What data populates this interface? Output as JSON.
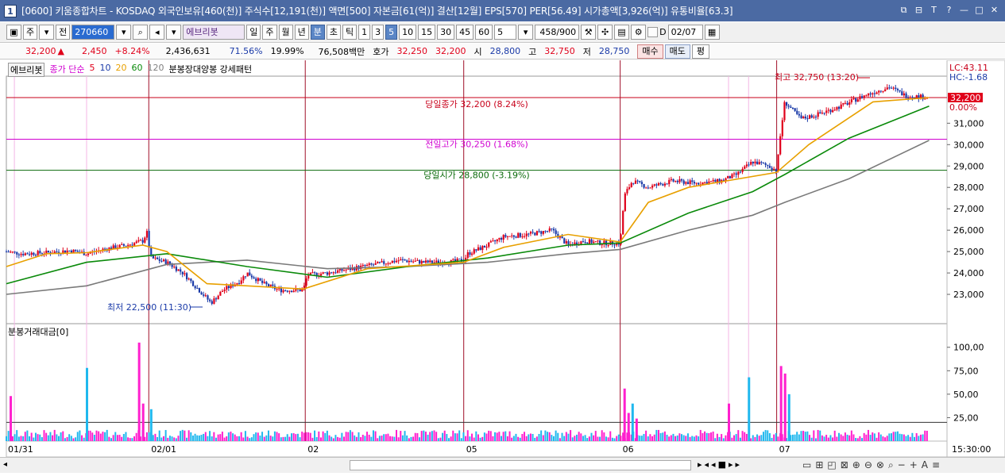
{
  "window": {
    "title": "[0600] 키움종합차트 - KOSDAQ 외국인보유[460(천)] 주식수[12,191(천)] 액면[500] 자본금[61(억)] 결산[12월] EPS[570] PER[56.49] 시가총액[3,926(억)] 유통비율[63.3]",
    "app_icon": "1",
    "controls": [
      "⧉",
      "⊟",
      "T",
      "?",
      "—",
      "□",
      "✕"
    ]
  },
  "toolbar": {
    "period_weekly": "주",
    "full": "전",
    "code": "270660",
    "stock_name": "에브리봇",
    "periods": [
      "일",
      "주",
      "월",
      "년",
      "분",
      "초",
      "틱"
    ],
    "selected_period": "분",
    "intervals": [
      "1",
      "3",
      "5",
      "10",
      "15",
      "30",
      "45",
      "60"
    ],
    "selected_interval": "5",
    "interval_value": "5",
    "count": "458/900",
    "checkbox_label": "D",
    "date": "02/07"
  },
  "quote": {
    "price": "32,200",
    "arrow": "▲",
    "change": "2,450",
    "change_pct": "+8.24%",
    "volume": "2,436,631",
    "pct1": "71.56%",
    "pct2": "19.99%",
    "amount": "76,508백만",
    "ask_label": "호가",
    "ask": "32,250",
    "bid": "32,200",
    "open_label": "시",
    "open": "28,800",
    "high_label": "고",
    "high": "32,750",
    "low_label": "저",
    "low": "28,750",
    "buy": "매수",
    "sell": "매도",
    "avg": "평"
  },
  "legend": {
    "stock": "에브리봇",
    "ma_label": "종가 단순",
    "ma": [
      "5",
      "10",
      "20",
      "60",
      "120"
    ],
    "ma_colors": [
      "#e0001a",
      "#1a3aa8",
      "#e8a000",
      "#0a8a0a",
      "#808080"
    ],
    "pattern": "분봉장대양봉 강세패턴",
    "volume_pane": "분봉거래대금[0]"
  },
  "annotations": {
    "high": "최고 32,750 (13:20)",
    "low": "최저 22,500 (11:30)",
    "today_close": "당일종가 32,200 (8.24%)",
    "prev_high": "전일고가 30,250 (1.68%)",
    "today_open": "당일시가 28,800 (-3.19%)",
    "lc": "LC:43.11",
    "hc": "HC:-1.68",
    "current_tag": "32,200",
    "zero_pct": "0.00%",
    "clock": "15:30:00"
  },
  "colors": {
    "up": "#e0001a",
    "down": "#1a3aa8",
    "vol_up": "#ff1fce",
    "vol_down": "#20b8ee",
    "close_line": "#c8001a",
    "prev_high_line": "#d000d0",
    "open_line": "#0a6a0a"
  },
  "chart_data": {
    "type": "candlestick",
    "price_axis": [
      "31,000",
      "30,000",
      "29,000",
      "28,000",
      "27,000",
      "26,000",
      "25,000",
      "24,000",
      "23,000"
    ],
    "price_ticks": [
      31000,
      30000,
      29000,
      28000,
      27000,
      26000,
      25000,
      24000,
      23000
    ],
    "ylim": [
      22000,
      33200
    ],
    "volume_axis": [
      "100,00",
      "75,00",
      "50,00",
      "25,00"
    ],
    "volume_ticks": [
      100,
      75,
      50,
      25
    ],
    "vol_ylim": [
      0,
      115
    ],
    "date_labels": [
      "01/31",
      "02/01",
      "02",
      "05",
      "06",
      "07"
    ],
    "day_boundaries": [
      0,
      0.1775,
      0.3725,
      0.57,
      0.765,
      0.96
    ],
    "reference_levels": {
      "today_close": 32200,
      "prev_high": 30250,
      "today_open": 28800
    },
    "price_path": [
      [
        0.0,
        25000
      ],
      [
        0.02,
        24900
      ],
      [
        0.05,
        24950
      ],
      [
        0.08,
        25050
      ],
      [
        0.1,
        24900
      ],
      [
        0.12,
        25100
      ],
      [
        0.15,
        25300
      ],
      [
        0.17,
        25500
      ],
      [
        0.175,
        25900
      ],
      [
        0.18,
        24700
      ],
      [
        0.2,
        24500
      ],
      [
        0.22,
        24000
      ],
      [
        0.24,
        23200
      ],
      [
        0.255,
        22600
      ],
      [
        0.27,
        23200
      ],
      [
        0.29,
        23600
      ],
      [
        0.3,
        24000
      ],
      [
        0.32,
        23500
      ],
      [
        0.34,
        23200
      ],
      [
        0.37,
        23200
      ],
      [
        0.375,
        23900
      ],
      [
        0.4,
        24000
      ],
      [
        0.43,
        24200
      ],
      [
        0.46,
        24400
      ],
      [
        0.49,
        24600
      ],
      [
        0.52,
        24500
      ],
      [
        0.55,
        24500
      ],
      [
        0.57,
        24600
      ],
      [
        0.575,
        24900
      ],
      [
        0.6,
        25300
      ],
      [
        0.62,
        25700
      ],
      [
        0.65,
        25800
      ],
      [
        0.68,
        26000
      ],
      [
        0.7,
        25300
      ],
      [
        0.72,
        25500
      ],
      [
        0.74,
        25400
      ],
      [
        0.765,
        25400
      ],
      [
        0.77,
        27600
      ],
      [
        0.78,
        28300
      ],
      [
        0.8,
        28000
      ],
      [
        0.83,
        28300
      ],
      [
        0.86,
        28200
      ],
      [
        0.89,
        28300
      ],
      [
        0.91,
        28600
      ],
      [
        0.93,
        29200
      ],
      [
        0.95,
        29000
      ],
      [
        0.96,
        28800
      ],
      [
        0.965,
        30600
      ],
      [
        0.97,
        32000
      ],
      [
        0.99,
        31200
      ],
      [
        1.01,
        31400
      ],
      [
        1.04,
        31800
      ],
      [
        1.07,
        32300
      ],
      [
        1.1,
        32700
      ],
      [
        1.12,
        32300
      ],
      [
        1.15,
        32200
      ]
    ],
    "ma_short": [
      [
        0.0,
        24300
      ],
      [
        0.05,
        24900
      ],
      [
        0.1,
        24950
      ],
      [
        0.17,
        25300
      ],
      [
        0.2,
        25000
      ],
      [
        0.25,
        23500
      ],
      [
        0.3,
        23400
      ],
      [
        0.37,
        23250
      ],
      [
        0.45,
        24200
      ],
      [
        0.57,
        24500
      ],
      [
        0.62,
        25200
      ],
      [
        0.7,
        25800
      ],
      [
        0.765,
        25450
      ],
      [
        0.8,
        27300
      ],
      [
        0.85,
        28000
      ],
      [
        0.96,
        28700
      ],
      [
        1.0,
        30000
      ],
      [
        1.08,
        32000
      ],
      [
        1.15,
        32200
      ]
    ],
    "ma_mid": [
      [
        0.0,
        23500
      ],
      [
        0.1,
        24500
      ],
      [
        0.2,
        24900
      ],
      [
        0.3,
        24300
      ],
      [
        0.4,
        23800
      ],
      [
        0.5,
        24300
      ],
      [
        0.6,
        24700
      ],
      [
        0.7,
        25300
      ],
      [
        0.765,
        25400
      ],
      [
        0.85,
        26800
      ],
      [
        0.93,
        27800
      ],
      [
        0.97,
        28600
      ],
      [
        1.05,
        30300
      ],
      [
        1.15,
        31800
      ]
    ],
    "ma_long": [
      [
        0.0,
        23000
      ],
      [
        0.1,
        23400
      ],
      [
        0.2,
        24400
      ],
      [
        0.3,
        24600
      ],
      [
        0.4,
        24200
      ],
      [
        0.5,
        24300
      ],
      [
        0.6,
        24500
      ],
      [
        0.7,
        24900
      ],
      [
        0.765,
        25100
      ],
      [
        0.85,
        26000
      ],
      [
        0.93,
        26700
      ],
      [
        0.97,
        27300
      ],
      [
        1.05,
        28400
      ],
      [
        1.15,
        30200
      ]
    ],
    "volume_spikes": [
      [
        0.005,
        48
      ],
      [
        0.1,
        78
      ],
      [
        0.165,
        105
      ],
      [
        0.17,
        40
      ],
      [
        0.18,
        34
      ],
      [
        0.77,
        56
      ],
      [
        0.775,
        30
      ],
      [
        0.78,
        40
      ],
      [
        0.785,
        24
      ],
      [
        0.9,
        40
      ],
      [
        0.925,
        68
      ],
      [
        0.965,
        80
      ],
      [
        0.97,
        72
      ],
      [
        0.975,
        50
      ]
    ]
  }
}
